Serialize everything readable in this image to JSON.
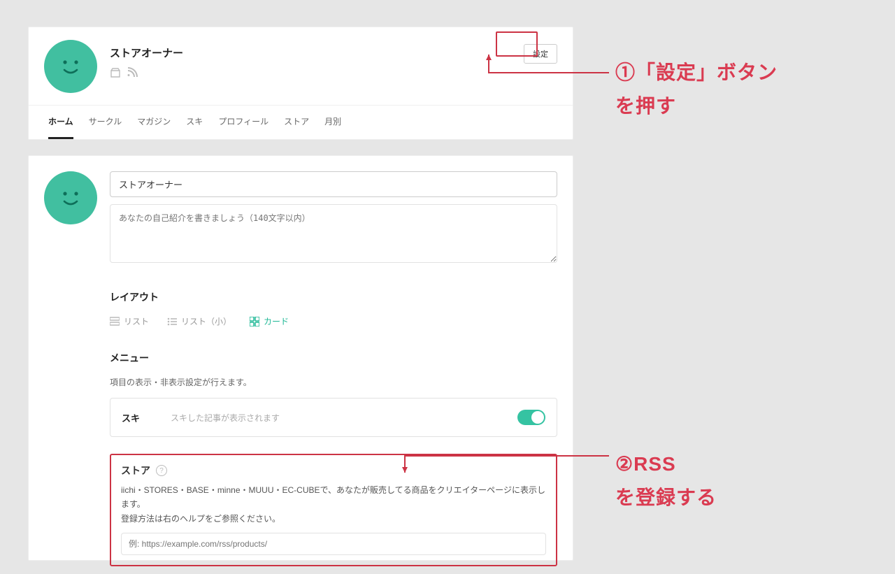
{
  "profile": {
    "name": "ストアオーナー",
    "settings_button": "設定"
  },
  "tabs": [
    {
      "label": "ホーム",
      "active": true
    },
    {
      "label": "サークル",
      "active": false
    },
    {
      "label": "マガジン",
      "active": false
    },
    {
      "label": "スキ",
      "active": false
    },
    {
      "label": "プロフィール",
      "active": false
    },
    {
      "label": "ストア",
      "active": false
    },
    {
      "label": "月別",
      "active": false
    }
  ],
  "form": {
    "name_value": "ストアオーナー",
    "bio_placeholder": "あなたの自己紹介を書きましょう（140文字以内）"
  },
  "layout": {
    "title": "レイアウト",
    "options": [
      {
        "label": "リスト",
        "active": false
      },
      {
        "label": "リスト（小）",
        "active": false
      },
      {
        "label": "カード",
        "active": true
      }
    ]
  },
  "menu": {
    "title": "メニュー",
    "desc": "項目の表示・非表示設定が行えます。",
    "row_label": "スキ",
    "row_hint": "スキした記事が表示されます"
  },
  "store": {
    "title": "ストア",
    "desc_line1": "iichi・STORES・BASE・minne・MUUU・EC-CUBEで、あなたが販売してる商品をクリエイターページに表示します。",
    "desc_line2": "登録方法は右のヘルプをご参照ください。",
    "input_placeholder": "例: https://example.com/rss/products/"
  },
  "callouts": {
    "c1_l1": "①「設定」ボタン",
    "c1_l2": "を押す",
    "c2_l1": "②RSS",
    "c2_l2": "を登録する"
  }
}
